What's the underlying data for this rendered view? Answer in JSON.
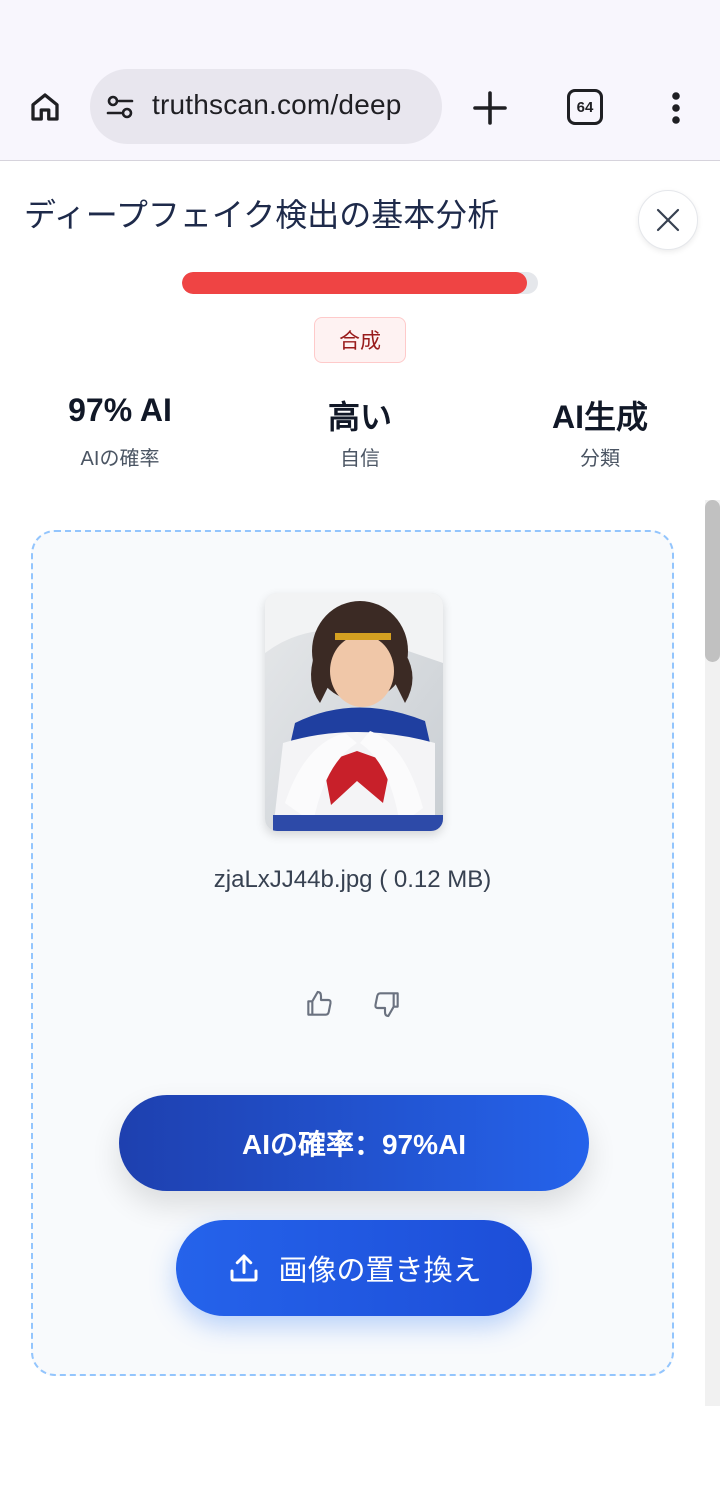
{
  "browser": {
    "url": "truthscan.com/deep",
    "tab_count": "64"
  },
  "page": {
    "title": "ディープフェイク検出の基本分析",
    "verdict_badge": "合成",
    "ai_probability_fraction": 0.97,
    "stats": [
      {
        "value": "97% AI",
        "label": "AIの確率"
      },
      {
        "value": "高い",
        "label": "自信"
      },
      {
        "value": "AI生成",
        "label": "分類"
      }
    ]
  },
  "upload": {
    "file_info": "zjaLxJJ44b.jpg ( 0.12 MB)",
    "result_button": "AIの確率：97%AI",
    "replace_button": "画像の置き換え"
  },
  "colors": {
    "verdict_red": "#ef4444",
    "primary_blue": "#2563eb",
    "dashed_border": "#93c5fd"
  },
  "icons": {
    "home": "home-icon",
    "site_settings": "tune-icon",
    "new_tab": "plus-icon",
    "tabs": "tab-switcher-icon",
    "menu": "more-vert-icon",
    "close": "close-icon",
    "like": "thumbs-up-icon",
    "dislike": "thumbs-down-icon",
    "upload": "upload-icon"
  }
}
